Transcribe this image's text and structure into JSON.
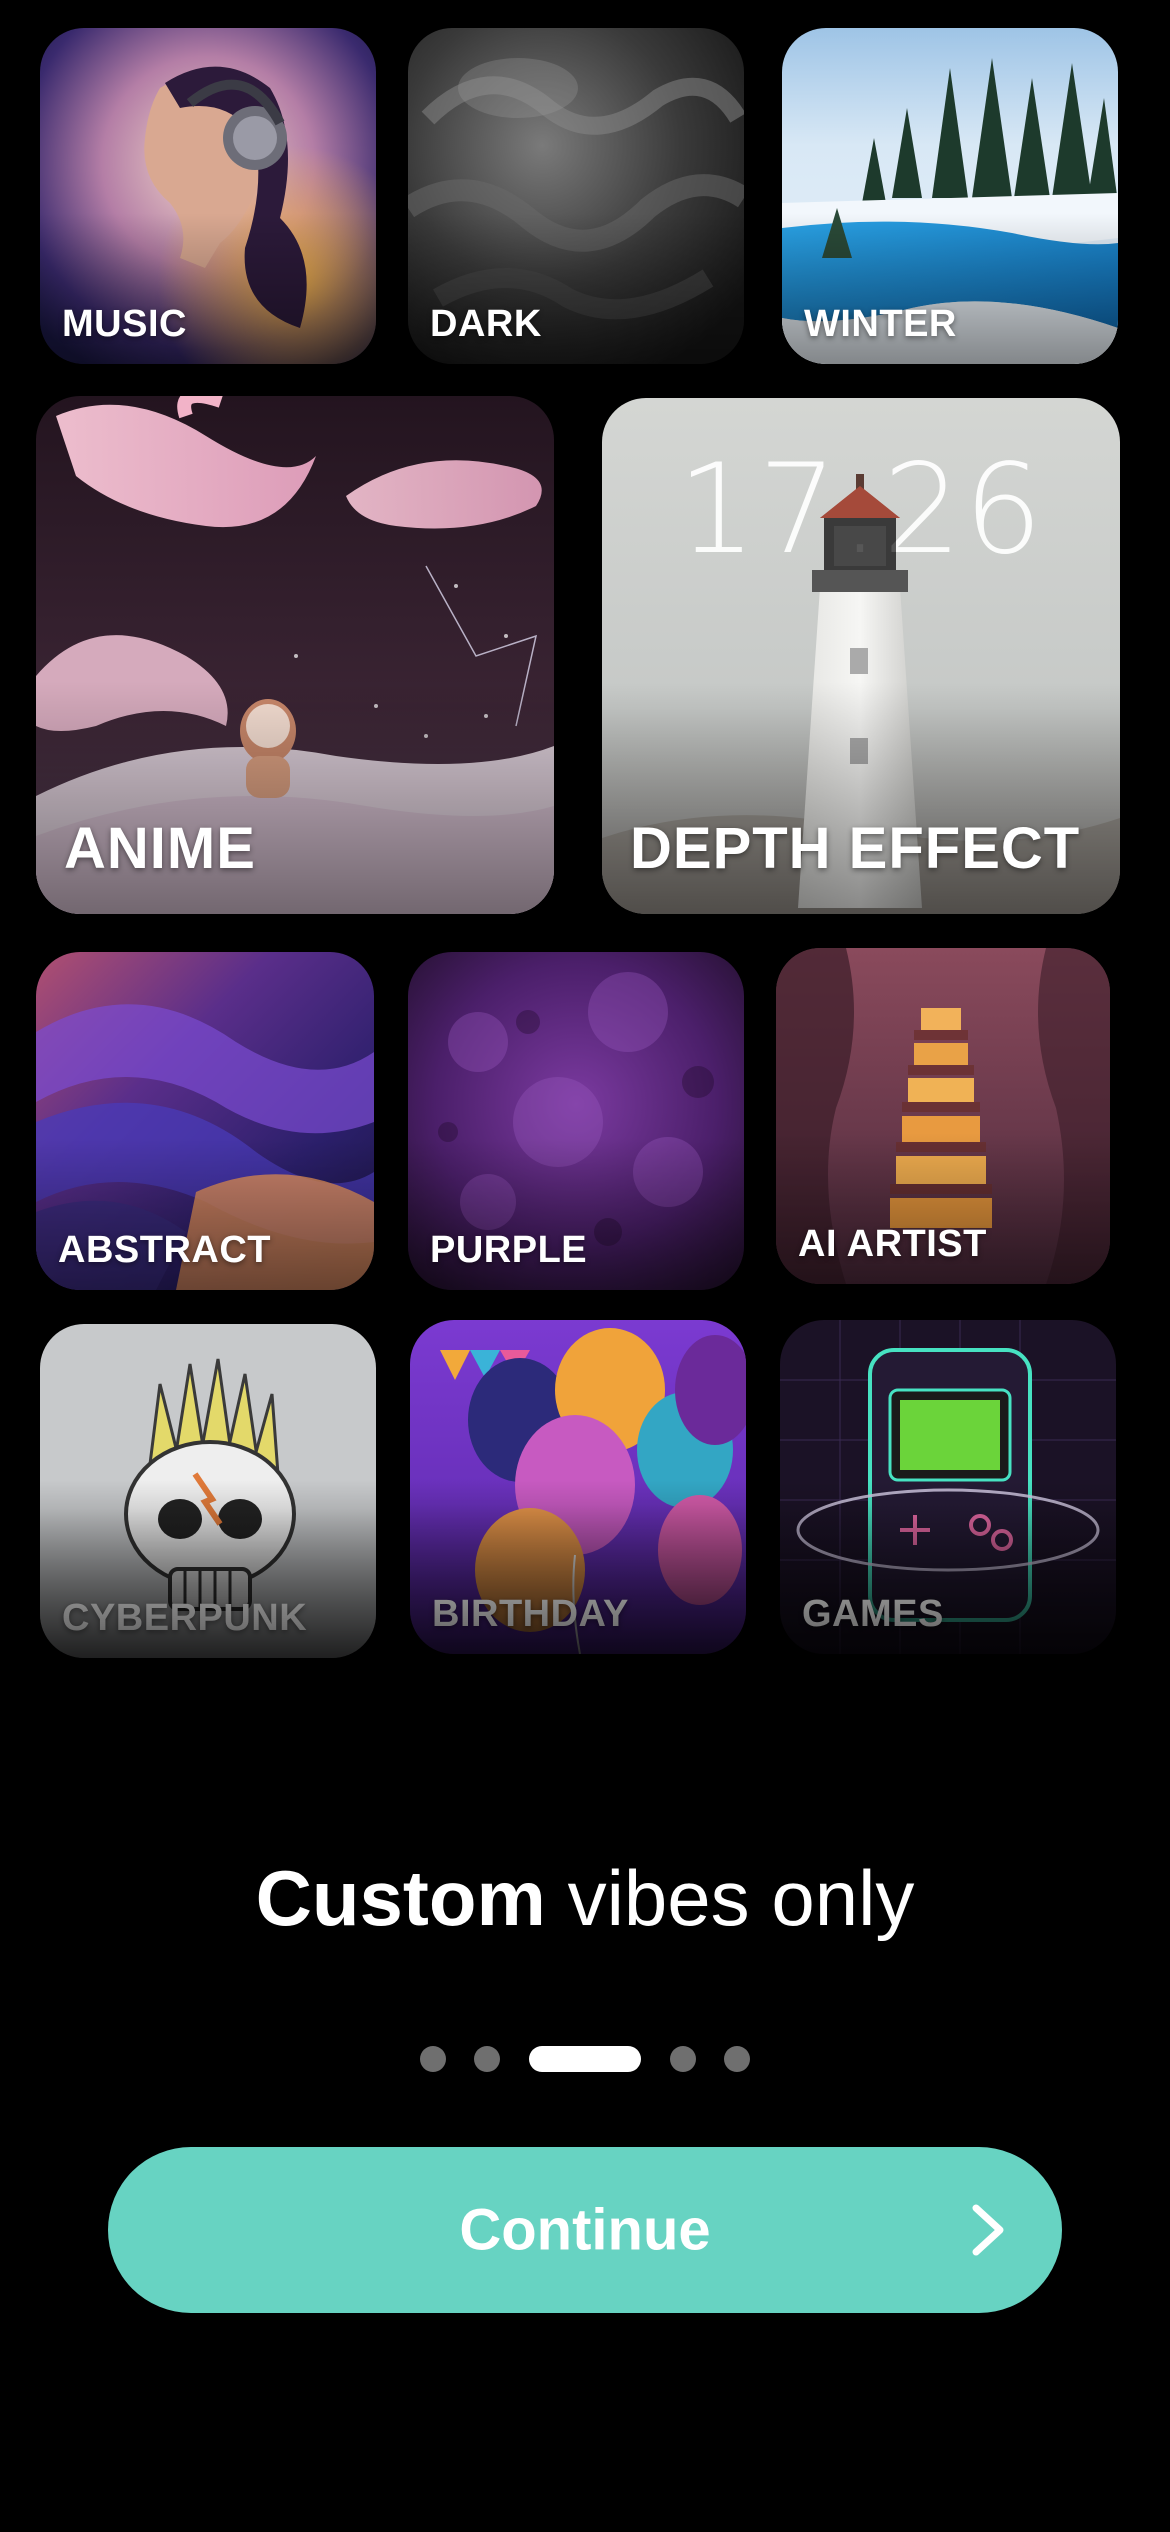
{
  "categories": [
    {
      "id": "music",
      "label": "MUSIC"
    },
    {
      "id": "dark",
      "label": "DARK"
    },
    {
      "id": "winter",
      "label": "WINTER"
    },
    {
      "id": "anime",
      "label": "ANIME"
    },
    {
      "id": "depth-effect",
      "label": "DEPTH EFFECT"
    },
    {
      "id": "abstract",
      "label": "ABSTRACT"
    },
    {
      "id": "purple",
      "label": "PURPLE"
    },
    {
      "id": "ai-artist",
      "label": "AI ARTIST"
    },
    {
      "id": "cyberpunk",
      "label": "CYBERPUNK"
    },
    {
      "id": "birthday",
      "label": "BIRTHDAY"
    },
    {
      "id": "games",
      "label": "GAMES"
    }
  ],
  "depth_effect_clock": "17:26",
  "headline": {
    "bold": "Custom",
    "light": "vibes only"
  },
  "pagination": {
    "total": 5,
    "active_index": 2
  },
  "continue_button": {
    "label": "Continue",
    "icon": "chevron-right-icon",
    "color": "#67d3c2"
  }
}
